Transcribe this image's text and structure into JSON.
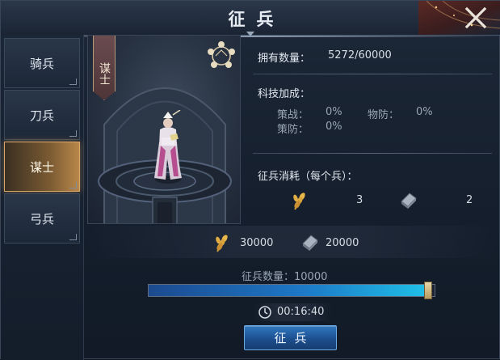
{
  "header": {
    "title": "征兵"
  },
  "sidebar": {
    "tabs": [
      {
        "label": "骑兵",
        "active": false
      },
      {
        "label": "刀兵",
        "active": false
      },
      {
        "label": "谋士",
        "active": true
      },
      {
        "label": "弓兵",
        "active": false
      }
    ]
  },
  "portrait": {
    "banner_label": "谋士"
  },
  "info": {
    "owned_label": "拥有数量：",
    "owned_value": "5272/60000",
    "tech_label": "科技加成：",
    "tech": {
      "strategy_label": "策战：",
      "strategy_value": "0%",
      "phys_def_label": "物防：",
      "phys_def_value": "0%",
      "strategy_def_label": "策防：",
      "strategy_def_value": "0%"
    },
    "cost_label": "征兵消耗（每个兵）：",
    "cost_grain": "3",
    "cost_iron": "2"
  },
  "totals": {
    "grain": "30000",
    "iron": "20000"
  },
  "recruit": {
    "quantity_label": "征兵数量：10000",
    "slider_fraction": 0.99,
    "time": "00:16:40",
    "button_label": "征兵"
  },
  "icons": {
    "grain": "wheat-icon",
    "iron": "iron-ingot-icon",
    "clock": "clock-icon",
    "close": "close-icon",
    "ring": "unit-type-ring-icon"
  },
  "colors": {
    "accent_blue": "#1fc0e8",
    "active_tab": "#b8874a",
    "button": "#2f79c0"
  }
}
